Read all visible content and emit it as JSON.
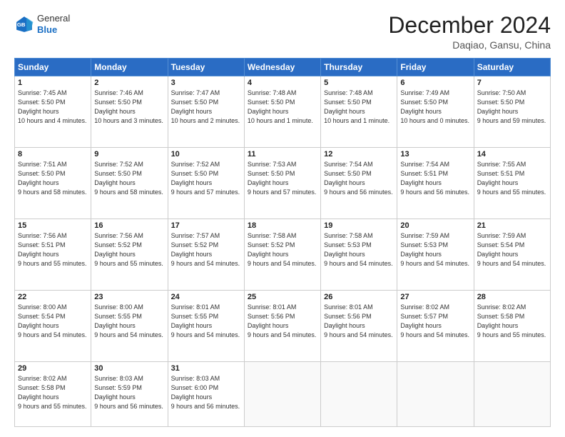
{
  "header": {
    "logo_general": "General",
    "logo_blue": "Blue",
    "month": "December 2024",
    "location": "Daqiao, Gansu, China"
  },
  "weekdays": [
    "Sunday",
    "Monday",
    "Tuesday",
    "Wednesday",
    "Thursday",
    "Friday",
    "Saturday"
  ],
  "weeks": [
    [
      {
        "day": "1",
        "sunrise": "7:45 AM",
        "sunset": "5:50 PM",
        "daylight": "10 hours and 4 minutes."
      },
      {
        "day": "2",
        "sunrise": "7:46 AM",
        "sunset": "5:50 PM",
        "daylight": "10 hours and 3 minutes."
      },
      {
        "day": "3",
        "sunrise": "7:47 AM",
        "sunset": "5:50 PM",
        "daylight": "10 hours and 2 minutes."
      },
      {
        "day": "4",
        "sunrise": "7:48 AM",
        "sunset": "5:50 PM",
        "daylight": "10 hours and 1 minute."
      },
      {
        "day": "5",
        "sunrise": "7:48 AM",
        "sunset": "5:50 PM",
        "daylight": "10 hours and 1 minute."
      },
      {
        "day": "6",
        "sunrise": "7:49 AM",
        "sunset": "5:50 PM",
        "daylight": "10 hours and 0 minutes."
      },
      {
        "day": "7",
        "sunrise": "7:50 AM",
        "sunset": "5:50 PM",
        "daylight": "9 hours and 59 minutes."
      }
    ],
    [
      {
        "day": "8",
        "sunrise": "7:51 AM",
        "sunset": "5:50 PM",
        "daylight": "9 hours and 58 minutes."
      },
      {
        "day": "9",
        "sunrise": "7:52 AM",
        "sunset": "5:50 PM",
        "daylight": "9 hours and 58 minutes."
      },
      {
        "day": "10",
        "sunrise": "7:52 AM",
        "sunset": "5:50 PM",
        "daylight": "9 hours and 57 minutes."
      },
      {
        "day": "11",
        "sunrise": "7:53 AM",
        "sunset": "5:50 PM",
        "daylight": "9 hours and 57 minutes."
      },
      {
        "day": "12",
        "sunrise": "7:54 AM",
        "sunset": "5:50 PM",
        "daylight": "9 hours and 56 minutes."
      },
      {
        "day": "13",
        "sunrise": "7:54 AM",
        "sunset": "5:51 PM",
        "daylight": "9 hours and 56 minutes."
      },
      {
        "day": "14",
        "sunrise": "7:55 AM",
        "sunset": "5:51 PM",
        "daylight": "9 hours and 55 minutes."
      }
    ],
    [
      {
        "day": "15",
        "sunrise": "7:56 AM",
        "sunset": "5:51 PM",
        "daylight": "9 hours and 55 minutes."
      },
      {
        "day": "16",
        "sunrise": "7:56 AM",
        "sunset": "5:52 PM",
        "daylight": "9 hours and 55 minutes."
      },
      {
        "day": "17",
        "sunrise": "7:57 AM",
        "sunset": "5:52 PM",
        "daylight": "9 hours and 54 minutes."
      },
      {
        "day": "18",
        "sunrise": "7:58 AM",
        "sunset": "5:52 PM",
        "daylight": "9 hours and 54 minutes."
      },
      {
        "day": "19",
        "sunrise": "7:58 AM",
        "sunset": "5:53 PM",
        "daylight": "9 hours and 54 minutes."
      },
      {
        "day": "20",
        "sunrise": "7:59 AM",
        "sunset": "5:53 PM",
        "daylight": "9 hours and 54 minutes."
      },
      {
        "day": "21",
        "sunrise": "7:59 AM",
        "sunset": "5:54 PM",
        "daylight": "9 hours and 54 minutes."
      }
    ],
    [
      {
        "day": "22",
        "sunrise": "8:00 AM",
        "sunset": "5:54 PM",
        "daylight": "9 hours and 54 minutes."
      },
      {
        "day": "23",
        "sunrise": "8:00 AM",
        "sunset": "5:55 PM",
        "daylight": "9 hours and 54 minutes."
      },
      {
        "day": "24",
        "sunrise": "8:01 AM",
        "sunset": "5:55 PM",
        "daylight": "9 hours and 54 minutes."
      },
      {
        "day": "25",
        "sunrise": "8:01 AM",
        "sunset": "5:56 PM",
        "daylight": "9 hours and 54 minutes."
      },
      {
        "day": "26",
        "sunrise": "8:01 AM",
        "sunset": "5:56 PM",
        "daylight": "9 hours and 54 minutes."
      },
      {
        "day": "27",
        "sunrise": "8:02 AM",
        "sunset": "5:57 PM",
        "daylight": "9 hours and 54 minutes."
      },
      {
        "day": "28",
        "sunrise": "8:02 AM",
        "sunset": "5:58 PM",
        "daylight": "9 hours and 55 minutes."
      }
    ],
    [
      {
        "day": "29",
        "sunrise": "8:02 AM",
        "sunset": "5:58 PM",
        "daylight": "9 hours and 55 minutes."
      },
      {
        "day": "30",
        "sunrise": "8:03 AM",
        "sunset": "5:59 PM",
        "daylight": "9 hours and 56 minutes."
      },
      {
        "day": "31",
        "sunrise": "8:03 AM",
        "sunset": "6:00 PM",
        "daylight": "9 hours and 56 minutes."
      },
      null,
      null,
      null,
      null
    ]
  ]
}
